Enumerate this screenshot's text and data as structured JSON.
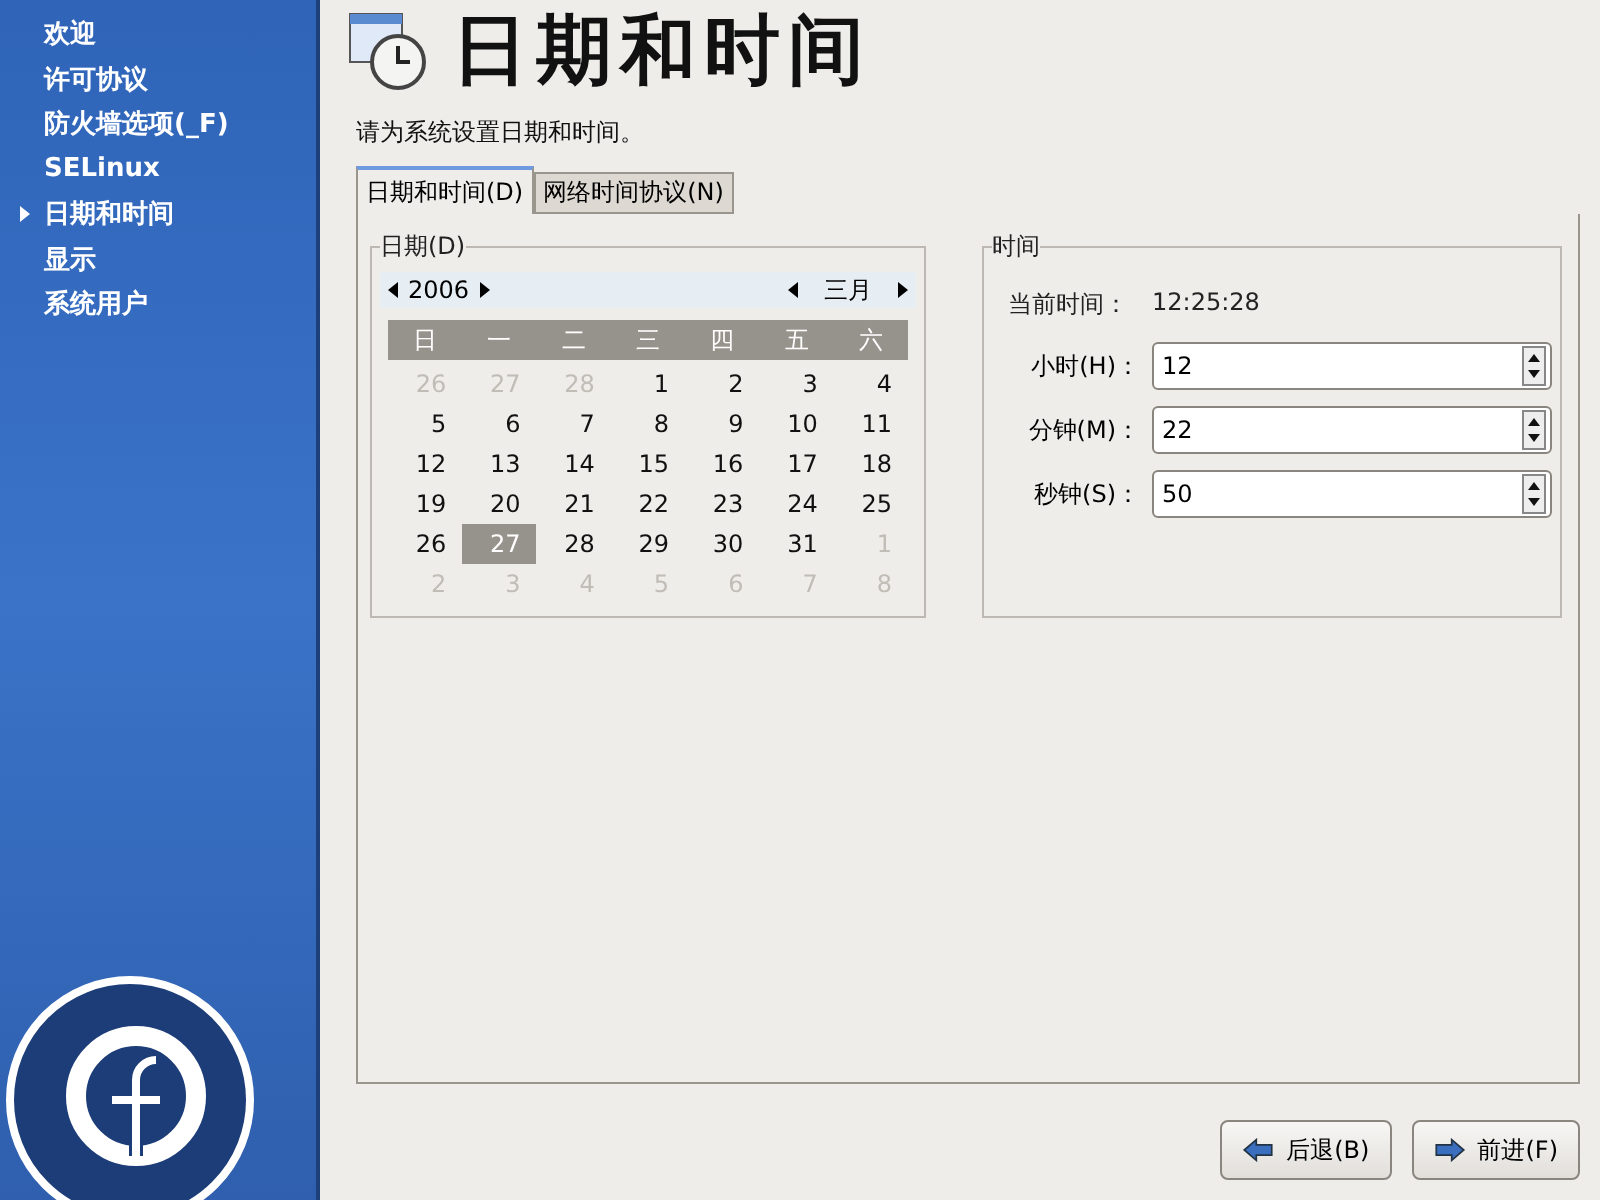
{
  "sidebar": {
    "items": [
      {
        "label": "欢迎",
        "selected": false
      },
      {
        "label": "许可协议",
        "selected": false
      },
      {
        "label": "防火墙选项(_F)",
        "selected": false
      },
      {
        "label": "SELinux",
        "selected": false
      },
      {
        "label": "日期和时间",
        "selected": true
      },
      {
        "label": "显示",
        "selected": false
      },
      {
        "label": "系统用户",
        "selected": false
      }
    ]
  },
  "header": {
    "title": "日期和时间",
    "subtitle": "请为系统设置日期和时间。"
  },
  "tabs": [
    {
      "label": "日期和时间(D)",
      "selected": true
    },
    {
      "label": "网络时间协议(N)",
      "selected": false
    }
  ],
  "date_frame": {
    "title": "日期(D)",
    "year": "2006",
    "month": "三月",
    "weekdays": [
      "日",
      "一",
      "二",
      "三",
      "四",
      "五",
      "六"
    ],
    "days": [
      {
        "text": "26",
        "outside": true,
        "selected": false
      },
      {
        "text": "27",
        "outside": true,
        "selected": false
      },
      {
        "text": "28",
        "outside": true,
        "selected": false
      },
      {
        "text": "1",
        "outside": false,
        "selected": false
      },
      {
        "text": "2",
        "outside": false,
        "selected": false
      },
      {
        "text": "3",
        "outside": false,
        "selected": false
      },
      {
        "text": "4",
        "outside": false,
        "selected": false
      },
      {
        "text": "5",
        "outside": false,
        "selected": false
      },
      {
        "text": "6",
        "outside": false,
        "selected": false
      },
      {
        "text": "7",
        "outside": false,
        "selected": false
      },
      {
        "text": "8",
        "outside": false,
        "selected": false
      },
      {
        "text": "9",
        "outside": false,
        "selected": false
      },
      {
        "text": "10",
        "outside": false,
        "selected": false
      },
      {
        "text": "11",
        "outside": false,
        "selected": false
      },
      {
        "text": "12",
        "outside": false,
        "selected": false
      },
      {
        "text": "13",
        "outside": false,
        "selected": false
      },
      {
        "text": "14",
        "outside": false,
        "selected": false
      },
      {
        "text": "15",
        "outside": false,
        "selected": false
      },
      {
        "text": "16",
        "outside": false,
        "selected": false
      },
      {
        "text": "17",
        "outside": false,
        "selected": false
      },
      {
        "text": "18",
        "outside": false,
        "selected": false
      },
      {
        "text": "19",
        "outside": false,
        "selected": false
      },
      {
        "text": "20",
        "outside": false,
        "selected": false
      },
      {
        "text": "21",
        "outside": false,
        "selected": false
      },
      {
        "text": "22",
        "outside": false,
        "selected": false
      },
      {
        "text": "23",
        "outside": false,
        "selected": false
      },
      {
        "text": "24",
        "outside": false,
        "selected": false
      },
      {
        "text": "25",
        "outside": false,
        "selected": false
      },
      {
        "text": "26",
        "outside": false,
        "selected": false
      },
      {
        "text": "27",
        "outside": false,
        "selected": true
      },
      {
        "text": "28",
        "outside": false,
        "selected": false
      },
      {
        "text": "29",
        "outside": false,
        "selected": false
      },
      {
        "text": "30",
        "outside": false,
        "selected": false
      },
      {
        "text": "31",
        "outside": false,
        "selected": false
      },
      {
        "text": "1",
        "outside": true,
        "selected": false
      },
      {
        "text": "2",
        "outside": true,
        "selected": false
      },
      {
        "text": "3",
        "outside": true,
        "selected": false
      },
      {
        "text": "4",
        "outside": true,
        "selected": false
      },
      {
        "text": "5",
        "outside": true,
        "selected": false
      },
      {
        "text": "6",
        "outside": true,
        "selected": false
      },
      {
        "text": "7",
        "outside": true,
        "selected": false
      },
      {
        "text": "8",
        "outside": true,
        "selected": false
      }
    ]
  },
  "time_frame": {
    "title": "时间",
    "current_label": "当前时间：",
    "current_value": "12:25:28",
    "fields": [
      {
        "label": "小时(H)：",
        "value": "12"
      },
      {
        "label": "分钟(M)：",
        "value": "22"
      },
      {
        "label": "秒钟(S)：",
        "value": "50"
      }
    ]
  },
  "buttons": [
    {
      "label": "后退(B)",
      "kind": "back"
    },
    {
      "label": "前进(F)",
      "kind": "forward"
    }
  ]
}
